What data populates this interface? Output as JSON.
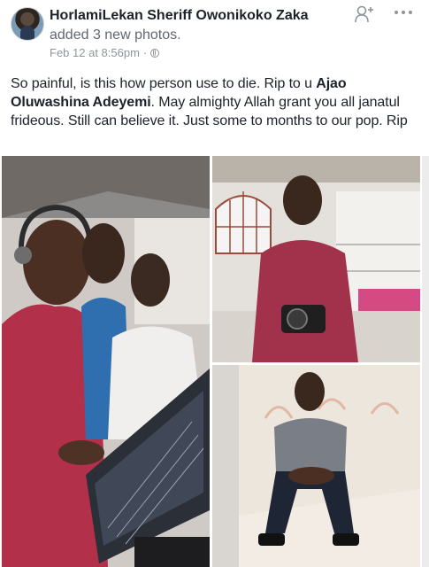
{
  "post": {
    "author": "HorlamiLekan Sheriff Owonikoko Zaka",
    "action": "added 3 new photos.",
    "timestamp": "Feb 12 at 8:56pm",
    "meta_separator": "·",
    "text_before": "So painful, is this how person use to die. Rip to u ",
    "text_bold": "Ajao Oluwashina Adeyemi",
    "text_after": ". May almighty Allah grant you all janatul frideous. Still can believe it. Just some to months to our pop. Rip"
  },
  "icons": {
    "add_friend": "add-friend-icon",
    "more": "more-icon",
    "privacy": "globe-icon"
  },
  "photos": [
    {
      "id": "photo-studio-group"
    },
    {
      "id": "photo-camera-man"
    },
    {
      "id": "photo-crouching-man"
    }
  ],
  "colors": {
    "name": "#1d2129",
    "secondary": "#616770",
    "meta": "#90949c"
  }
}
